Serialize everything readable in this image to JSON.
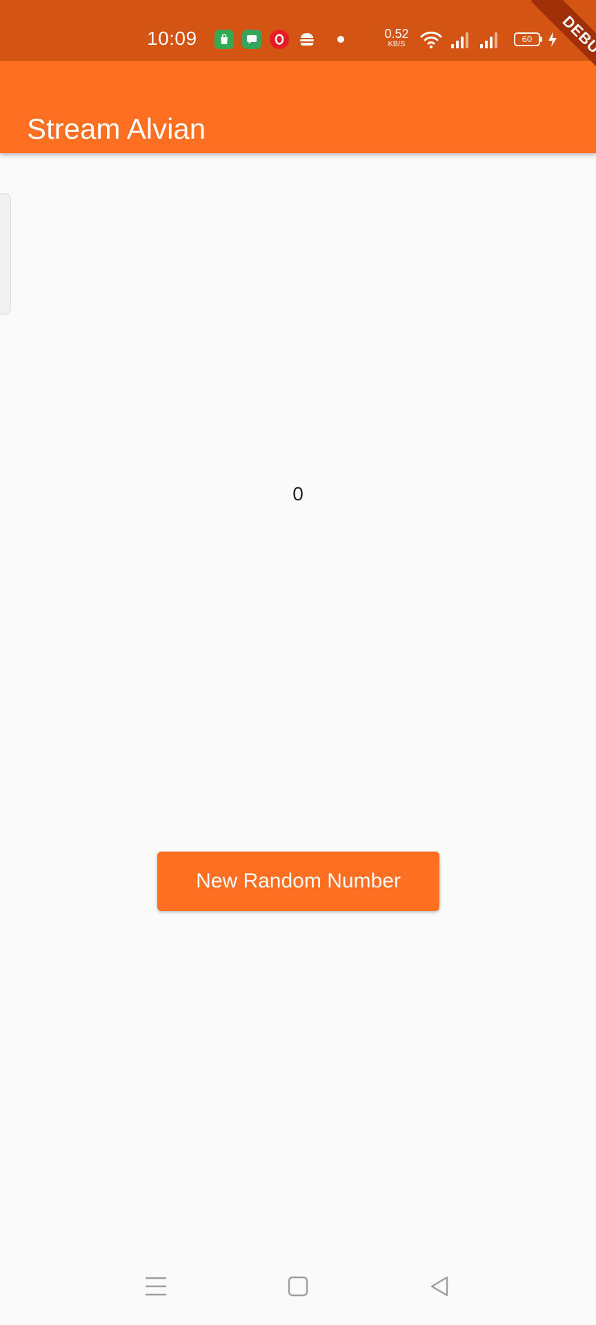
{
  "status_bar": {
    "time": "10:09",
    "net_speed_value": "0.52",
    "net_speed_unit": "KB/S",
    "battery": "60",
    "notification_icons": [
      "shopping-bag-icon",
      "message-icon",
      "opera-icon",
      "burger-icon"
    ],
    "system_icons": [
      "wifi-icon",
      "signal-icon",
      "signal-icon",
      "battery-icon",
      "charging-icon"
    ]
  },
  "app_bar": {
    "title": "Stream Alvian"
  },
  "debug_banner": "DEBUG",
  "main": {
    "number": "0",
    "button_label": "New Random Number"
  },
  "nav_bar": {
    "buttons": [
      "menu-icon",
      "home-icon",
      "back-icon"
    ]
  },
  "colors": {
    "status_bar": "#d35413",
    "primary": "#ff6f21",
    "background": "#fafafa",
    "debug_banner": "#a12f08"
  }
}
